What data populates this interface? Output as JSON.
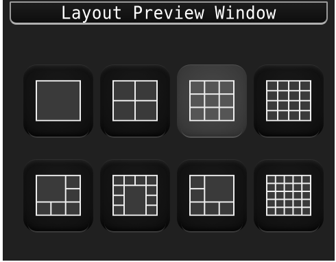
{
  "window": {
    "title": "Layout Preview Window"
  },
  "layouts": [
    {
      "id": "layout-1",
      "description": "single",
      "selected": false
    },
    {
      "id": "layout-4",
      "description": "2x2",
      "selected": false
    },
    {
      "id": "layout-9",
      "description": "3x3",
      "selected": true
    },
    {
      "id": "layout-16",
      "description": "4x4",
      "selected": false
    },
    {
      "id": "layout-6",
      "description": "1 large + 5",
      "selected": false
    },
    {
      "id": "layout-8",
      "description": "1 large center + 7",
      "selected": false
    },
    {
      "id": "layout-5",
      "description": "1 large + 4",
      "selected": false
    },
    {
      "id": "layout-25",
      "description": "5x5",
      "selected": false
    }
  ],
  "colors": {
    "background": "#202020",
    "tile": "#111111",
    "tile_selected": "#3d3d3d",
    "grid_lines": "#eeeeee"
  }
}
